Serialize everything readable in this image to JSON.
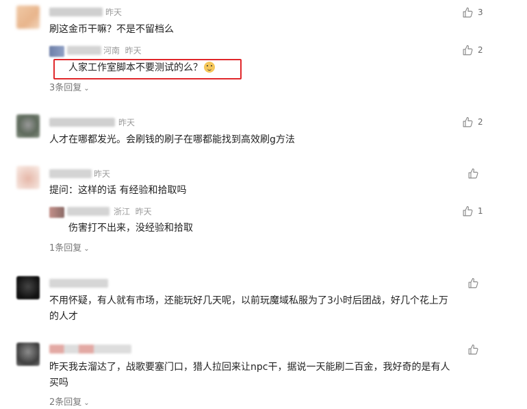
{
  "comments": [
    {
      "time": "昨天",
      "text": "刷这金币干嘛？不是不留档么",
      "likes": "3",
      "reply": {
        "location": "河南",
        "time": "昨天",
        "text": "人家工作室脚本不要测试的么？",
        "emoji_icon": "smiling-face-icon",
        "likes": "2",
        "highlight_color": "#e0262a"
      },
      "replies_label": "3条回复"
    },
    {
      "time": "昨天",
      "text": "人才在哪都发光。会刷钱的刷子在哪都能找到高效刷g方法",
      "likes": "2"
    },
    {
      "time": "昨天",
      "text": "提问：这样的话 有经验和拾取吗",
      "likes": "",
      "reply": {
        "location": "浙江",
        "time": "昨天",
        "text": "伤害打不出来，没经验和拾取",
        "likes": "1"
      },
      "replies_label": "1条回复"
    },
    {
      "text_line1": "不用怀疑，有人就有市场，还能玩好几天呢，以前玩魔域私服为了3小时后团战，好几个花上万",
      "text_line2": "的人才",
      "likes": ""
    },
    {
      "text_line1": "昨天我去溜达了，战歌要塞门口，猎人拉回来让npc干，据说一天能刷二百金，我好奇的是有人",
      "text_line2": "买吗",
      "likes": "",
      "replies_label": "2条回复"
    }
  ],
  "icons": {
    "like": "thumbs-up-icon",
    "expand": "chevron-down-icon"
  }
}
